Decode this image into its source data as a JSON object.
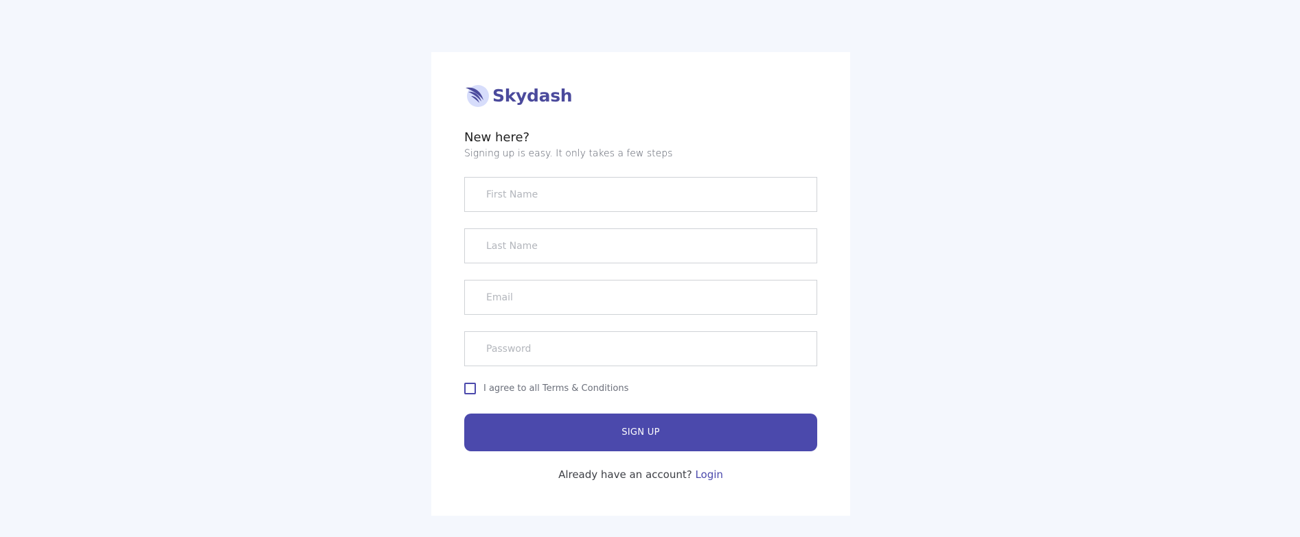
{
  "brand": {
    "name": "Skydash",
    "accent_color": "#4b4a9c",
    "icon": "wing-logo-icon"
  },
  "intro": {
    "heading": "New here?",
    "subheading": "Signing up is easy. It only takes a few steps"
  },
  "form": {
    "first_name": {
      "placeholder": "First Name",
      "value": ""
    },
    "last_name": {
      "placeholder": "Last Name",
      "value": ""
    },
    "email": {
      "placeholder": "Email",
      "value": ""
    },
    "password": {
      "placeholder": "Password",
      "value": ""
    },
    "terms_label": "I agree to all Terms & Conditions",
    "terms_checked": false,
    "submit_label": "SIGN UP",
    "submit_color": "#4b49ac"
  },
  "footer": {
    "prompt": "Already have an account?",
    "login_label": "Login"
  }
}
